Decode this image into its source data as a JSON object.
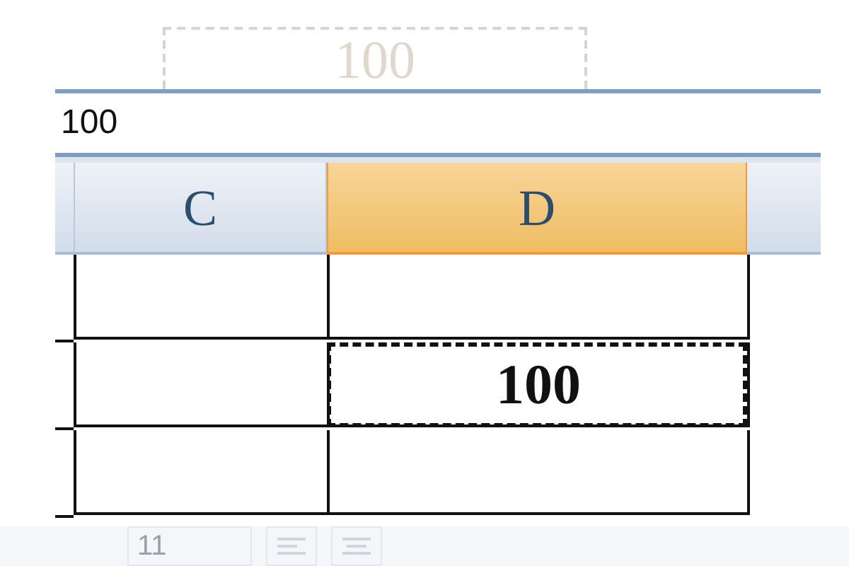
{
  "background": {
    "copied_cell": "100"
  },
  "formula_bar": {
    "value": "100"
  },
  "columns": [
    {
      "label": "C",
      "selected": false
    },
    {
      "label": "D",
      "selected": true
    }
  ],
  "rows": [
    {
      "cells": [
        {
          "selected": false
        },
        {
          "selected": false
        }
      ]
    },
    {
      "cells": [
        {
          "selected": false
        },
        {
          "value": "100",
          "selected": true
        }
      ]
    },
    {
      "cells": [
        {
          "selected": false
        },
        {
          "selected": false
        }
      ]
    }
  ],
  "toolbar": {
    "font_size": "11"
  }
}
